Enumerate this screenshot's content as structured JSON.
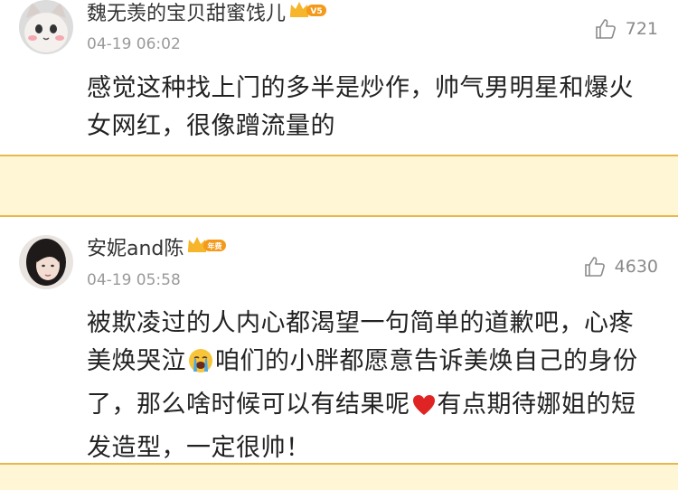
{
  "comments": [
    {
      "username": "魏无羡的宝贝甜蜜饯儿",
      "badge": "V5",
      "time": "04-19 06:02",
      "likes": "721",
      "text": "感觉这种找上门的多半是炒作，帅气男明星和爆火女网红，很像蹭流量的"
    },
    {
      "username": "安妮and陈",
      "badge": "年费",
      "time": "04-19 05:58",
      "likes": "4630",
      "text_part1": "被欺凌过的人内心都渴望一句简单的道歉吧，心疼美焕哭泣",
      "text_part2": "咱们的小胖都愿意告诉美焕自己的身份了，那么啥时候可以有结果呢",
      "text_part3": "有点期待娜姐的短发造型，一定很帅！"
    }
  ],
  "icons": {
    "like": "thumbs-up-icon",
    "crown": "crown-icon",
    "cry_emoji": "crying-face-emoji-icon",
    "heart_emoji": "red-heart-emoji-icon"
  },
  "colors": {
    "separator_bg": "#fff6d6",
    "separator_border": "#e9b84a",
    "badge_orange": "#f39a1a",
    "crown_gold": "#f6b52a",
    "heart_red": "#e02323"
  }
}
